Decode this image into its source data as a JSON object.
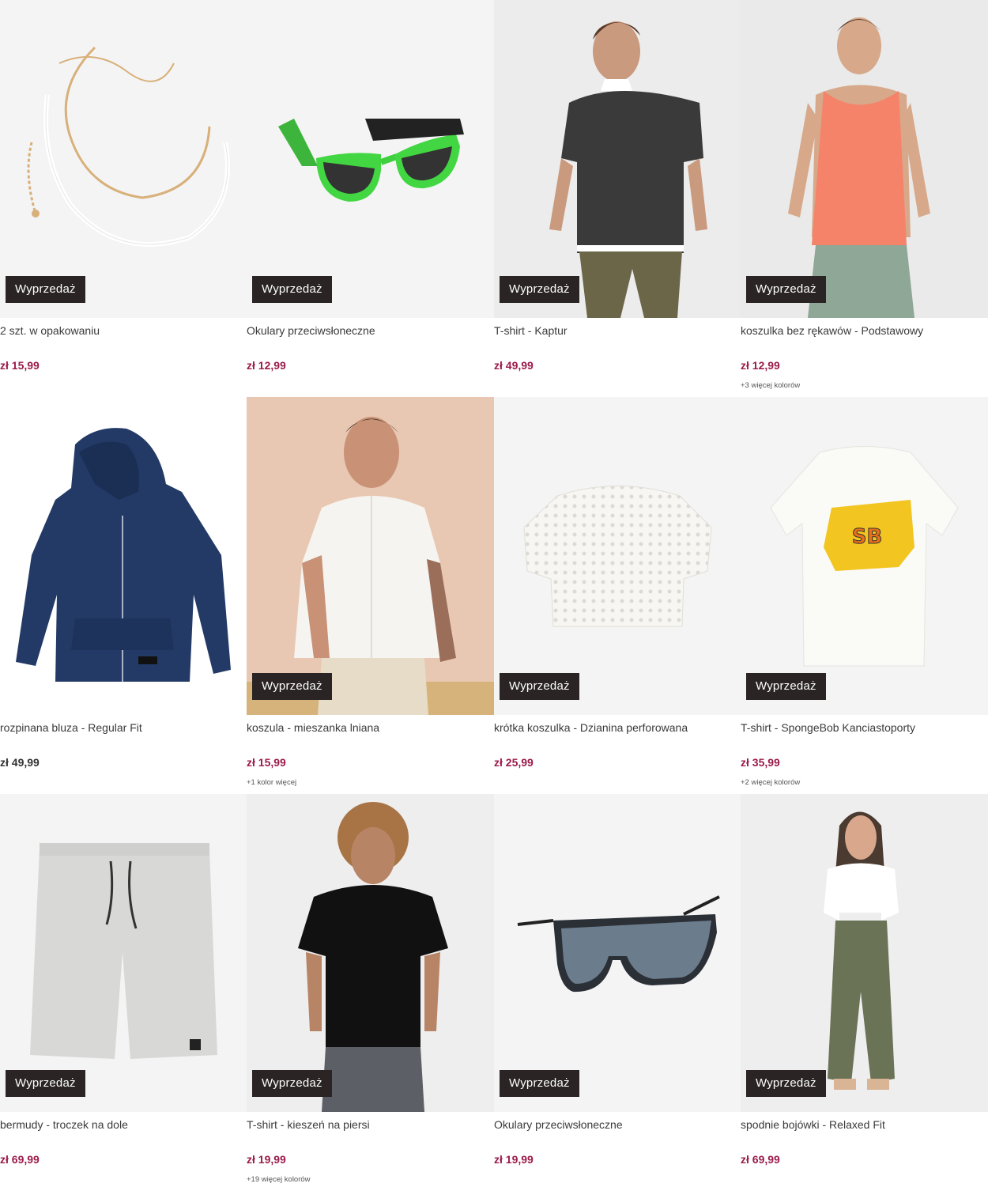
{
  "badge_label": "Wyprzedaż",
  "colors": {
    "price_sale": "#9b1b4a",
    "price_regular": "#333333",
    "badge_bg": "#2a2524"
  },
  "products": [
    {
      "title": "2 szt. w opakowaniu",
      "price": "zł 15,99",
      "sale_price": true,
      "more_colors": "",
      "image": "necklace"
    },
    {
      "title": "Okulary przeciwsłoneczne",
      "price": "zł 12,99",
      "sale_price": true,
      "more_colors": "",
      "image": "sunglasses-green"
    },
    {
      "title": "T-shirt - Kaptur",
      "price": "zł 49,99",
      "sale_price": true,
      "more_colors": "",
      "image": "hooded-tshirt-model"
    },
    {
      "title": "koszulka bez rękawów - Podstawowy",
      "price": "zł 12,99",
      "sale_price": true,
      "more_colors": "+3 więcej kolorów",
      "image": "tank-top-model"
    },
    {
      "title": "rozpinana bluza - Regular Fit",
      "price": "zł 49,99",
      "sale_price": false,
      "more_colors": "",
      "image": "zip-hoodie"
    },
    {
      "title": "koszula - mieszanka lniana",
      "price": "zł 15,99",
      "sale_price": true,
      "more_colors": "+1 kolor więcej",
      "image": "linen-shirt-model"
    },
    {
      "title": "krótka koszulka - Dzianina perforowana",
      "price": "zł 25,99",
      "sale_price": true,
      "more_colors": "",
      "image": "crochet-top"
    },
    {
      "title": "T-shirt - SpongeBob Kanciastoporty",
      "price": "zł 35,99",
      "sale_price": true,
      "more_colors": "+2 więcej kolorów",
      "image": "spongebob-tshirt"
    },
    {
      "title": "bermudy - troczek na dole",
      "price": "zł 69,99",
      "sale_price": true,
      "more_colors": "",
      "image": "grey-shorts"
    },
    {
      "title": "T-shirt - kieszeń na piersi",
      "price": "zł 19,99",
      "sale_price": true,
      "more_colors": "+19 więcej kolorów",
      "image": "black-tshirt-model"
    },
    {
      "title": "Okulary przeciwsłoneczne",
      "price": "zł 19,99",
      "sale_price": true,
      "more_colors": "",
      "image": "sunglasses-shield"
    },
    {
      "title": "spodnie bojówki - Relaxed Fit",
      "price": "zł 69,99",
      "sale_price": true,
      "more_colors": "",
      "image": "cargo-pants-model"
    }
  ]
}
